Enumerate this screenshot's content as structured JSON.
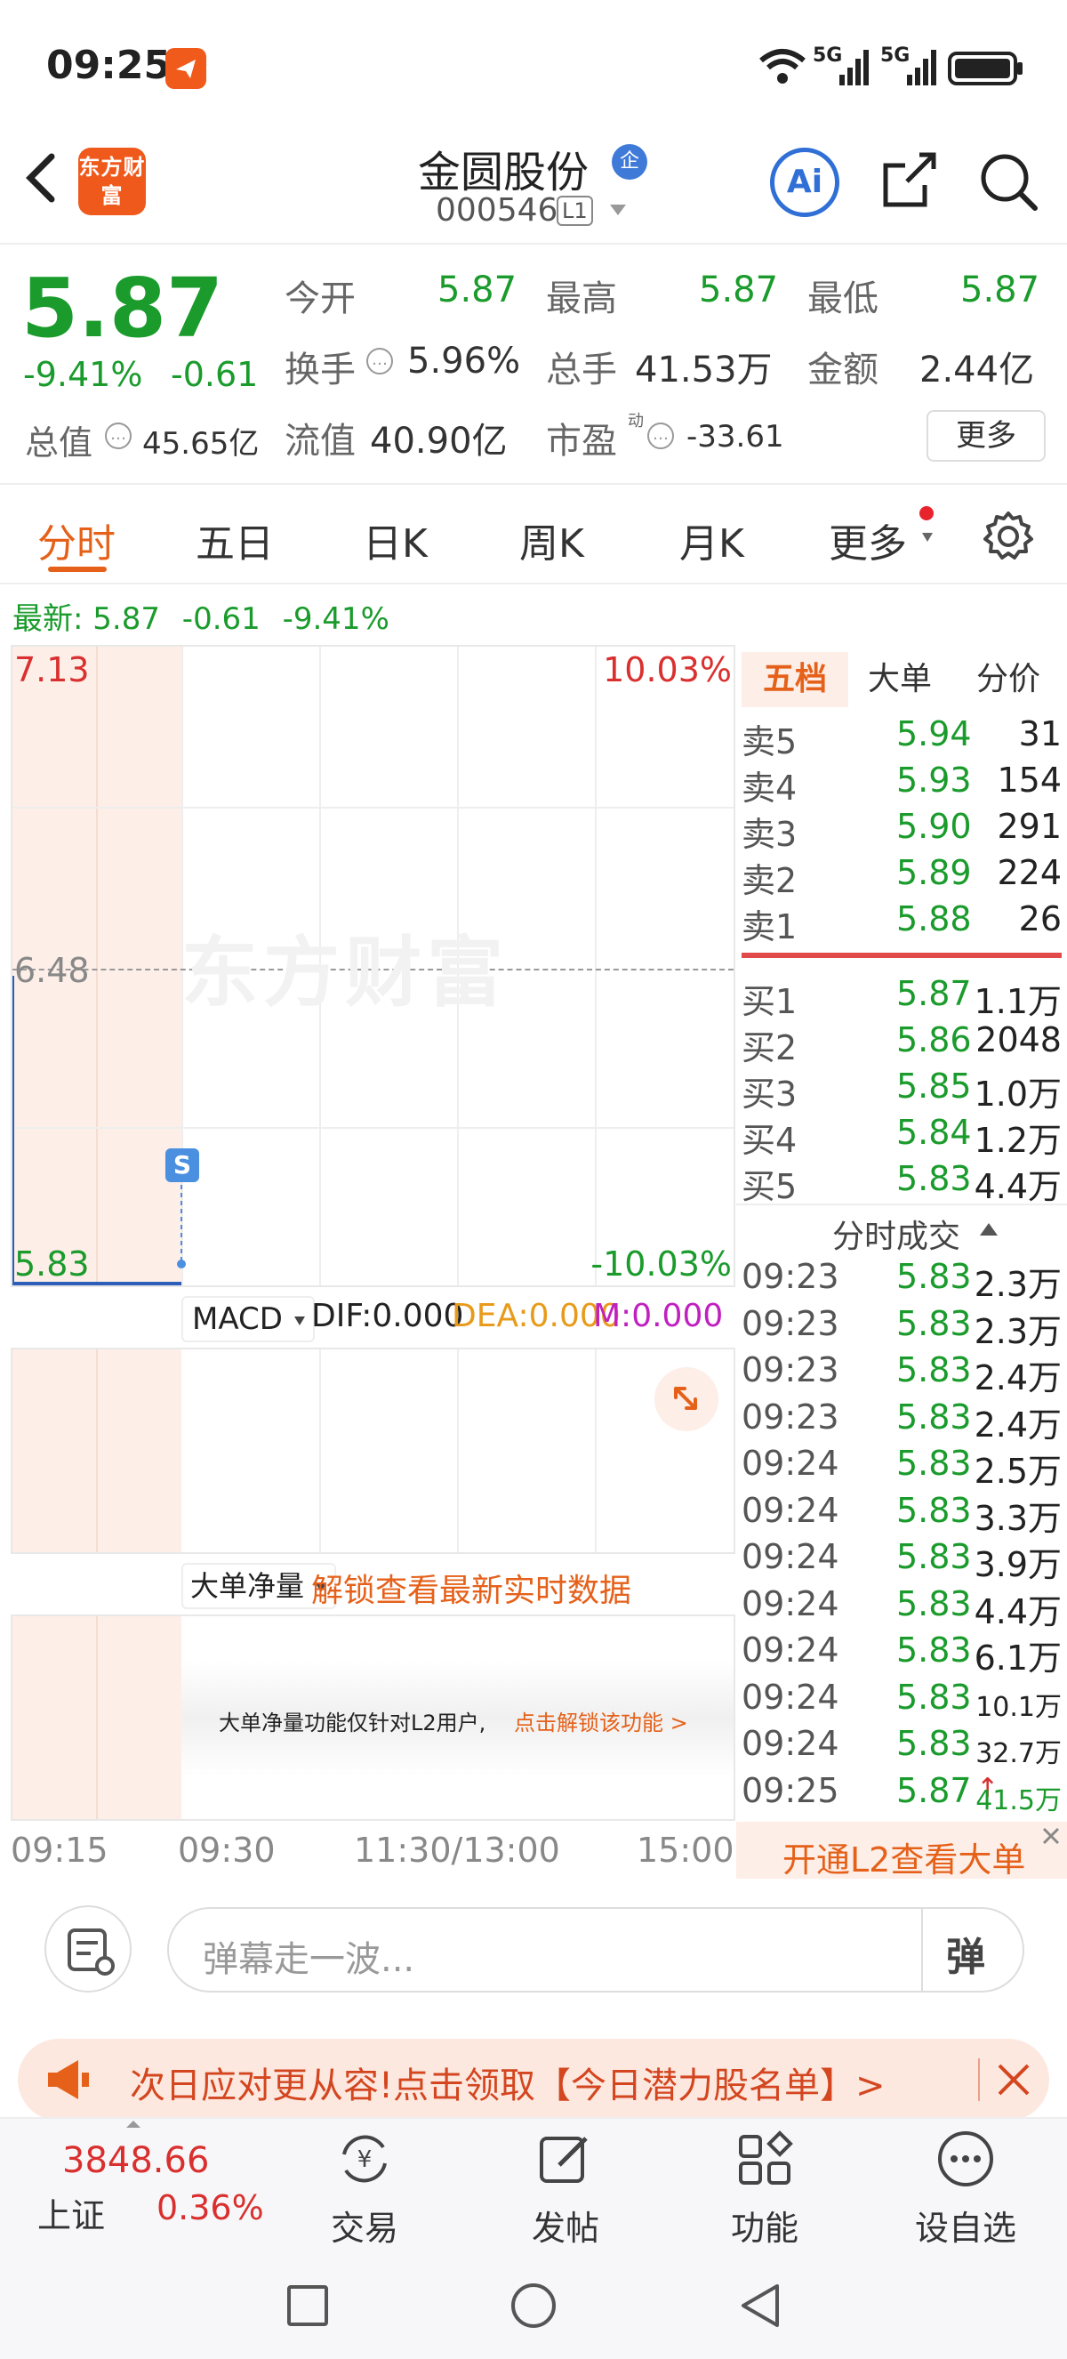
{
  "status": {
    "time": "09:25",
    "signal1": "5G",
    "signal2": "5G"
  },
  "header": {
    "logo_text": "东方财富",
    "name": "金圆股份",
    "badge": "企",
    "code": "000546",
    "level": "L1",
    "ai_label": "Ai"
  },
  "quote": {
    "price": "5.87",
    "change_pct": "-9.41%",
    "change": "-0.61",
    "total_value_label": "总值",
    "total_value": "45.65亿",
    "open_label": "今开",
    "open": "5.87",
    "high_label": "最高",
    "high": "5.87",
    "low_label": "最低",
    "low": "5.87",
    "turnover_label": "换手",
    "turnover": "5.96%",
    "volume_label": "总手",
    "volume": "41.53万",
    "amount_label": "金额",
    "amount": "2.44亿",
    "float_label": "流值",
    "float_value": "40.90亿",
    "pe_label": "市盈",
    "pe_sup": "动",
    "pe": "-33.61",
    "more_button": "更多"
  },
  "tabs": [
    "分时",
    "五日",
    "日K",
    "周K",
    "月K",
    "更多"
  ],
  "latest": {
    "label": "最新:",
    "price": "5.87",
    "change": "-0.61",
    "pct": "-9.41%"
  },
  "chart": {
    "y_top": "7.13",
    "y_mid": "6.48",
    "y_bottom": "5.83",
    "pct_top": "10.03%",
    "pct_bottom": "-10.03%",
    "watermark": "东方财富",
    "marker": "S",
    "time_labels": [
      "09:15",
      "09:30",
      "11:30/13:00",
      "15:00"
    ]
  },
  "macd": {
    "select": "MACD",
    "dif": "DIF:0.000",
    "dea": "DEA:0.000",
    "m": "M:0.000"
  },
  "bignet": {
    "select": "大单净量",
    "unlock": "解锁查看最新实时数据",
    "notice": "大单净量功能仅针对L2用户,",
    "notice_link": "点击解锁该功能 >"
  },
  "orderbook": {
    "tabs": [
      "五档",
      "大单",
      "分价"
    ],
    "sells": [
      {
        "label": "卖5",
        "price": "5.94",
        "vol": "31"
      },
      {
        "label": "卖4",
        "price": "5.93",
        "vol": "154"
      },
      {
        "label": "卖3",
        "price": "5.90",
        "vol": "291"
      },
      {
        "label": "卖2",
        "price": "5.89",
        "vol": "224"
      },
      {
        "label": "卖1",
        "price": "5.88",
        "vol": "26"
      }
    ],
    "buys": [
      {
        "label": "买1",
        "price": "5.87",
        "vol": "1.1万"
      },
      {
        "label": "买2",
        "price": "5.86",
        "vol": "2048"
      },
      {
        "label": "买3",
        "price": "5.85",
        "vol": "1.0万"
      },
      {
        "label": "买4",
        "price": "5.84",
        "vol": "1.2万"
      },
      {
        "label": "买5",
        "price": "5.83",
        "vol": "4.4万"
      }
    ],
    "ticks_title": "分时成交",
    "ticks": [
      {
        "time": "09:23",
        "price": "5.83",
        "vol": "2.3万"
      },
      {
        "time": "09:23",
        "price": "5.83",
        "vol": "2.3万"
      },
      {
        "time": "09:23",
        "price": "5.83",
        "vol": "2.4万"
      },
      {
        "time": "09:23",
        "price": "5.83",
        "vol": "2.4万"
      },
      {
        "time": "09:24",
        "price": "5.83",
        "vol": "2.5万"
      },
      {
        "time": "09:24",
        "price": "5.83",
        "vol": "3.3万"
      },
      {
        "time": "09:24",
        "price": "5.83",
        "vol": "3.9万"
      },
      {
        "time": "09:24",
        "price": "5.83",
        "vol": "4.4万"
      },
      {
        "time": "09:24",
        "price": "5.83",
        "vol": "6.1万"
      },
      {
        "time": "09:24",
        "price": "5.83",
        "vol": "10.1万"
      },
      {
        "time": "09:24",
        "price": "5.83",
        "vol": "32.7万"
      },
      {
        "time": "09:25",
        "price": "5.87",
        "vol": "41.5万"
      }
    ],
    "l2_button": "开通L2查看大单"
  },
  "comment": {
    "placeholder": "弹幕走一波...",
    "danmu": "弹"
  },
  "banner": {
    "text": "次日应对更从容!点击领取【今日潜力股名单】>"
  },
  "bottom": {
    "index_value": "3848.66",
    "index_name": "上证",
    "index_pct": "0.36%",
    "items": [
      "交易",
      "发帖",
      "功能",
      "设自选"
    ]
  }
}
